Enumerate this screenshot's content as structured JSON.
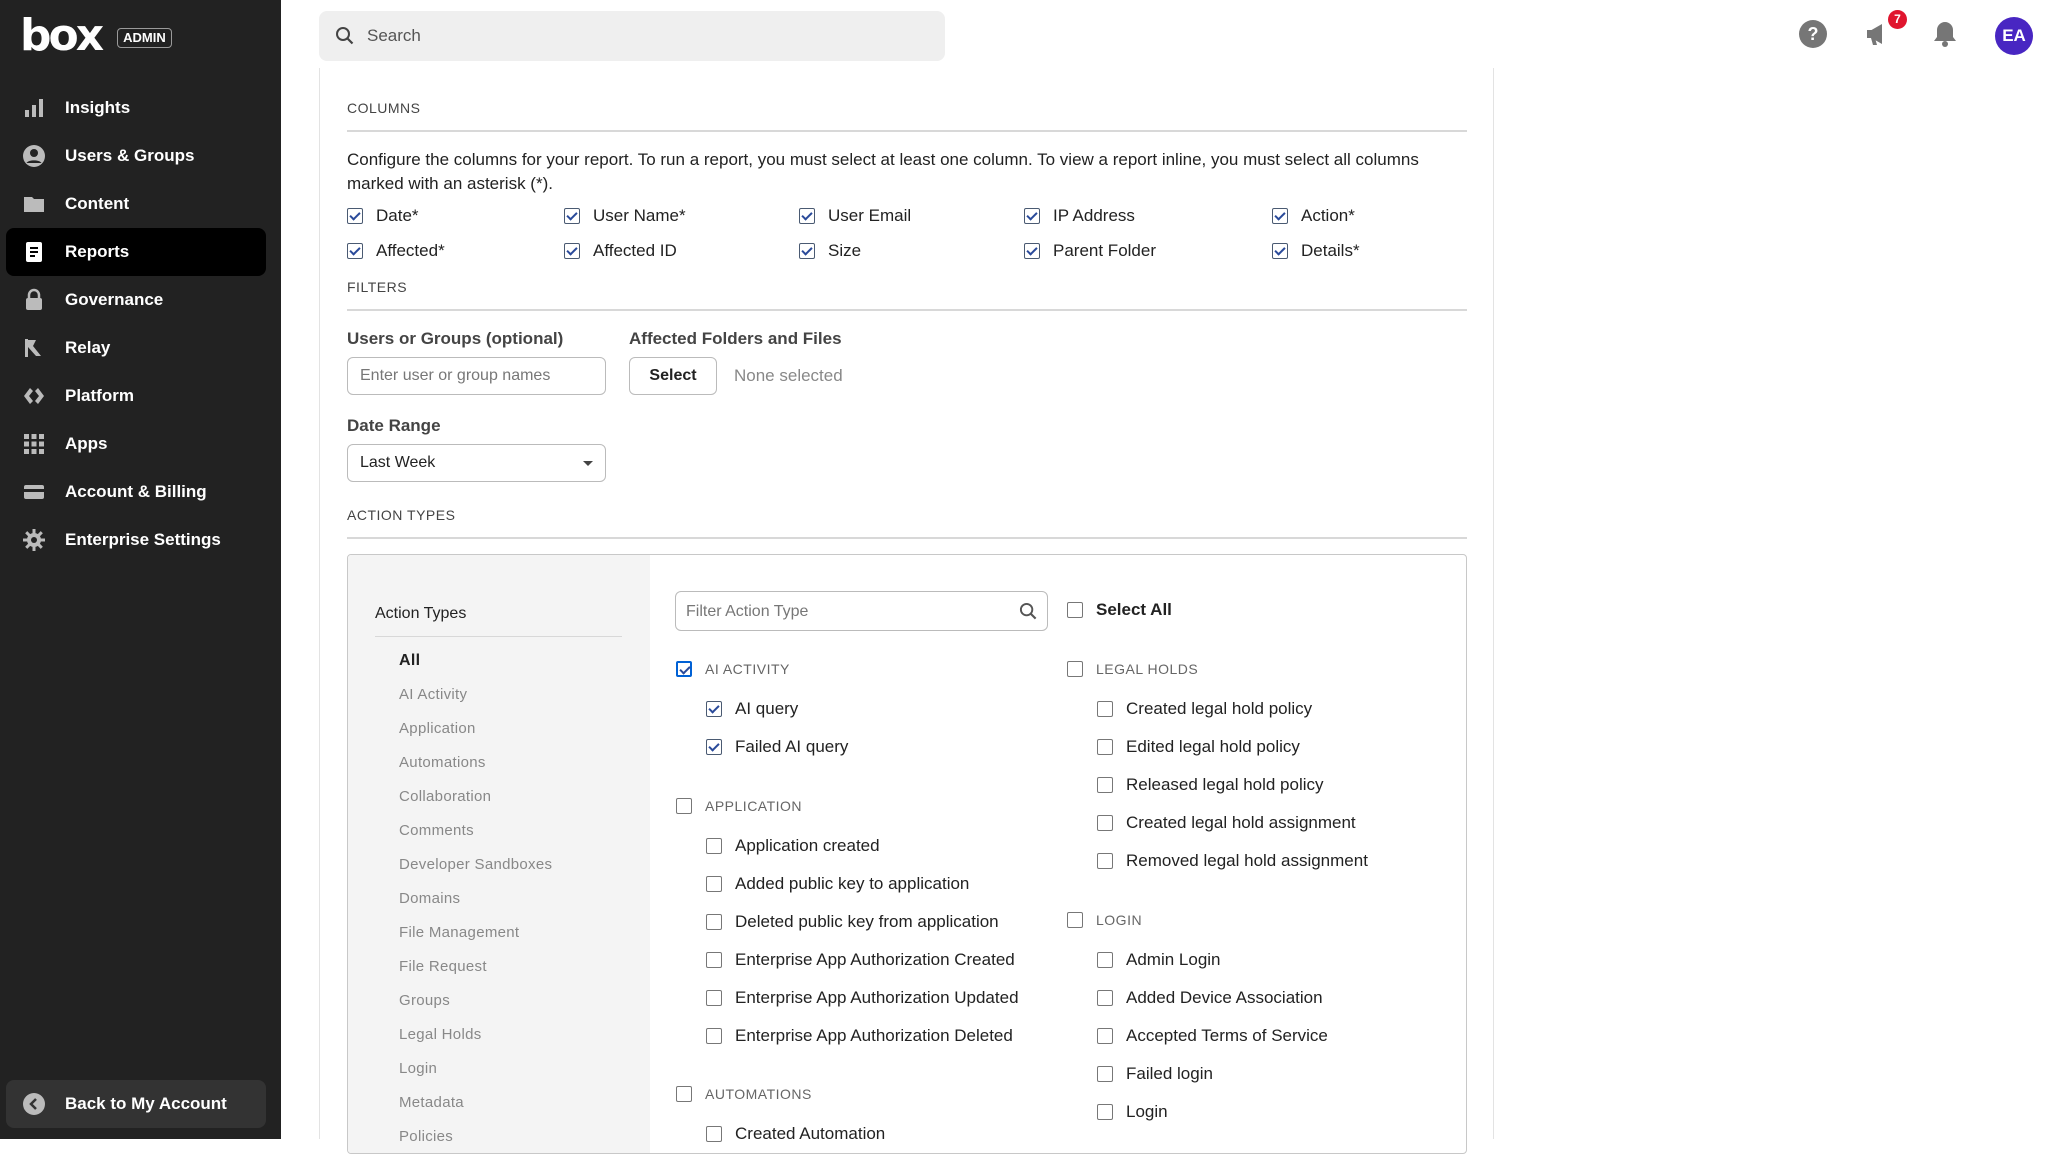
{
  "sidebar": {
    "brand": "box",
    "badge": "ADMIN",
    "items": [
      {
        "label": "Insights",
        "icon": "bar-chart-icon"
      },
      {
        "label": "Users & Groups",
        "icon": "user-circle-icon"
      },
      {
        "label": "Content",
        "icon": "folder-icon"
      },
      {
        "label": "Reports",
        "icon": "report-document-icon"
      },
      {
        "label": "Governance",
        "icon": "lock-icon"
      },
      {
        "label": "Relay",
        "icon": "relay-flag-icon"
      },
      {
        "label": "Platform",
        "icon": "code-diamond-icon"
      },
      {
        "label": "Apps",
        "icon": "grid-icon"
      },
      {
        "label": "Account & Billing",
        "icon": "credit-card-icon"
      },
      {
        "label": "Enterprise Settings",
        "icon": "gear-icon"
      }
    ],
    "active": "Reports",
    "back": "Back to My Account"
  },
  "topbar": {
    "search_placeholder": "Search",
    "notification_count": "7",
    "avatar_initials": "EA"
  },
  "columns": {
    "heading": "COLUMNS",
    "description": "Configure the columns for your report. To run a report, you must select at least one column. To view a report inline, you must select all columns marked with an asterisk (*).",
    "items": [
      {
        "label": "Date*",
        "checked": true
      },
      {
        "label": "User Name*",
        "checked": true
      },
      {
        "label": "User Email",
        "checked": true
      },
      {
        "label": "IP Address",
        "checked": true
      },
      {
        "label": "Action*",
        "checked": true
      },
      {
        "label": "Affected*",
        "checked": true
      },
      {
        "label": "Affected ID",
        "checked": true
      },
      {
        "label": "Size",
        "checked": true
      },
      {
        "label": "Parent Folder",
        "checked": true
      },
      {
        "label": "Details*",
        "checked": true
      }
    ]
  },
  "filters": {
    "heading": "FILTERS",
    "users_label": "Users or Groups (optional)",
    "users_placeholder": "Enter user or group names",
    "affected_label": "Affected Folders and Files",
    "select_button": "Select",
    "none_selected": "None selected",
    "date_label": "Date Range",
    "date_value": "Last Week"
  },
  "action_types": {
    "heading": "ACTION TYPES",
    "panel_title": "Action Types",
    "categories": [
      "All",
      "AI Activity",
      "Application",
      "Automations",
      "Collaboration",
      "Comments",
      "Developer Sandboxes",
      "Domains",
      "File Management",
      "File Request",
      "Groups",
      "Legal Holds",
      "Login",
      "Metadata",
      "Policies"
    ],
    "active_category": "All",
    "filter_placeholder": "Filter Action Type",
    "select_all": "Select All",
    "left_groups": [
      {
        "name": "AI ACTIVITY",
        "checked": true,
        "items": [
          {
            "label": "AI query",
            "checked": true
          },
          {
            "label": "Failed AI query",
            "checked": true
          }
        ]
      },
      {
        "name": "APPLICATION",
        "checked": false,
        "items": [
          {
            "label": "Application created",
            "checked": false
          },
          {
            "label": "Added public key to application",
            "checked": false
          },
          {
            "label": "Deleted public key from application",
            "checked": false
          },
          {
            "label": "Enterprise App Authorization Created",
            "checked": false
          },
          {
            "label": "Enterprise App Authorization Updated",
            "checked": false
          },
          {
            "label": "Enterprise App Authorization Deleted",
            "checked": false
          }
        ]
      },
      {
        "name": "AUTOMATIONS",
        "checked": false,
        "items": [
          {
            "label": "Created Automation",
            "checked": false
          }
        ]
      }
    ],
    "right_groups": [
      {
        "name": "LEGAL HOLDS",
        "checked": false,
        "items": [
          {
            "label": "Created legal hold policy",
            "checked": false
          },
          {
            "label": "Edited legal hold policy",
            "checked": false
          },
          {
            "label": "Released legal hold policy",
            "checked": false
          },
          {
            "label": "Created legal hold assignment",
            "checked": false
          },
          {
            "label": "Removed legal hold assignment",
            "checked": false
          }
        ]
      },
      {
        "name": "LOGIN",
        "checked": false,
        "items": [
          {
            "label": "Admin Login",
            "checked": false
          },
          {
            "label": "Added Device Association",
            "checked": false
          },
          {
            "label": "Accepted Terms of Service",
            "checked": false
          },
          {
            "label": "Failed login",
            "checked": false
          },
          {
            "label": "Login",
            "checked": false
          }
        ]
      }
    ]
  },
  "colors": {
    "sidebar_bg": "#222222",
    "active_nav_bg": "#000000",
    "avatar_bg": "#4826c2",
    "badge_red": "#e0152e",
    "check_blue": "#0061d5"
  }
}
